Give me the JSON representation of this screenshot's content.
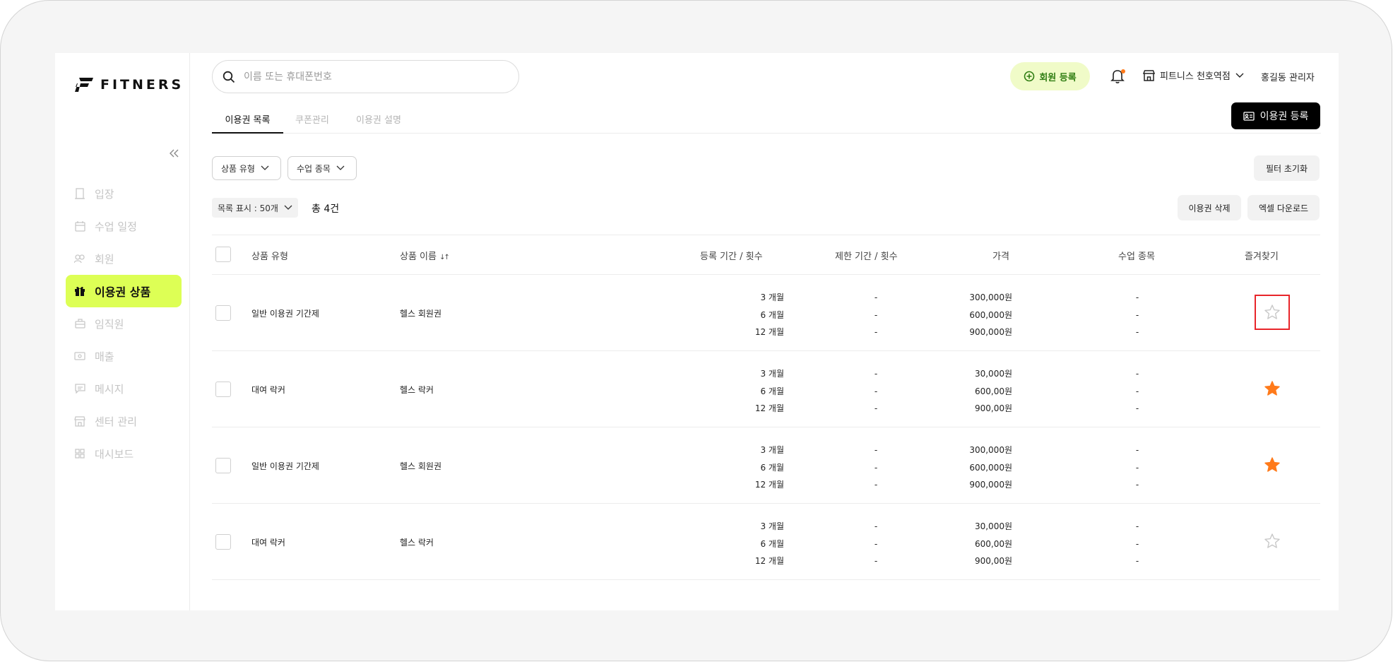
{
  "brand": {
    "logo_text": "FITNERS"
  },
  "sidebar": {
    "items": [
      {
        "label": "입장",
        "icon": "door-icon",
        "active": false
      },
      {
        "label": "수업 일정",
        "icon": "calendar-icon",
        "active": false
      },
      {
        "label": "회원",
        "icon": "members-icon",
        "active": false
      },
      {
        "label": "이용권 상품",
        "icon": "gift-icon",
        "active": true
      },
      {
        "label": "임직원",
        "icon": "briefcase-icon",
        "active": false
      },
      {
        "label": "매출",
        "icon": "money-icon",
        "active": false
      },
      {
        "label": "메시지",
        "icon": "message-icon",
        "active": false
      },
      {
        "label": "센터 관리",
        "icon": "store-icon",
        "active": false
      },
      {
        "label": "대시보드",
        "icon": "dashboard-icon",
        "active": false
      }
    ]
  },
  "header": {
    "search_placeholder": "이름 또는 휴대폰번호",
    "register_member_label": "회원 등록",
    "center_name": "피트니스 천호역점",
    "admin_name": "홍길동 관리자"
  },
  "tabs": [
    {
      "label": "이용권 목록",
      "active": true
    },
    {
      "label": "쿠폰관리",
      "active": false
    },
    {
      "label": "이용권 설명",
      "active": false
    }
  ],
  "actions": {
    "register_pass_label": "이용권 등록",
    "reset_filter_label": "필터 초기화",
    "delete_pass_label": "이용권 삭제",
    "excel_download_label": "엑셀 다운로드"
  },
  "filters": {
    "product_type_label": "상품 유형",
    "class_type_label": "수업 종목"
  },
  "list": {
    "display_label": "목록 표시 : 50개",
    "total_label": "총 4건"
  },
  "table": {
    "headers": {
      "product_type": "상품 유형",
      "product_name": "상품 이름",
      "sort_glyph": "↓↑",
      "period": "등록 기간 / 횟수",
      "limit": "제한 기간 / 횟수",
      "price": "가격",
      "class_type": "수업 종목",
      "favorite": "즐겨찾기"
    },
    "rows": [
      {
        "product_type": "일반 이용권 기간제",
        "product_name": "헬스 회원권",
        "periods": [
          "3 개월",
          "6 개월",
          "12 개월"
        ],
        "limits": [
          "-",
          "-",
          "-"
        ],
        "prices": [
          "300,000원",
          "600,000원",
          "900,000원"
        ],
        "classes": [
          "-",
          "-",
          "-"
        ],
        "favorite": false,
        "highlighted": true
      },
      {
        "product_type": "대여 락커",
        "product_name": "헬스 락커",
        "periods": [
          "3 개월",
          "6 개월",
          "12 개월"
        ],
        "limits": [
          "-",
          "-",
          "-"
        ],
        "prices": [
          "30,000원",
          "600,00원",
          "900,00원"
        ],
        "classes": [
          "-",
          "-",
          "-"
        ],
        "favorite": true,
        "highlighted": false
      },
      {
        "product_type": "일반 이용권 기간제",
        "product_name": "헬스 회원권",
        "periods": [
          "3 개월",
          "6 개월",
          "12 개월"
        ],
        "limits": [
          "-",
          "-",
          "-"
        ],
        "prices": [
          "300,000원",
          "600,000원",
          "900,000원"
        ],
        "classes": [
          "-",
          "-",
          "-"
        ],
        "favorite": true,
        "highlighted": false
      },
      {
        "product_type": "대여 락커",
        "product_name": "헬스 락커",
        "periods": [
          "3 개월",
          "6 개월",
          "12 개월"
        ],
        "limits": [
          "-",
          "-",
          "-"
        ],
        "prices": [
          "30,000원",
          "600,00원",
          "900,00원"
        ],
        "classes": [
          "-",
          "-",
          "-"
        ],
        "favorite": false,
        "highlighted": false
      }
    ]
  },
  "colors": {
    "accent": "#ddff55",
    "star_active": "#ff7a1a",
    "star_inactive": "#c8c8c8",
    "selection_outline": "#e8252a",
    "register_member_bg": "#f0fbc8",
    "register_member_fg": "#2f7d12"
  }
}
